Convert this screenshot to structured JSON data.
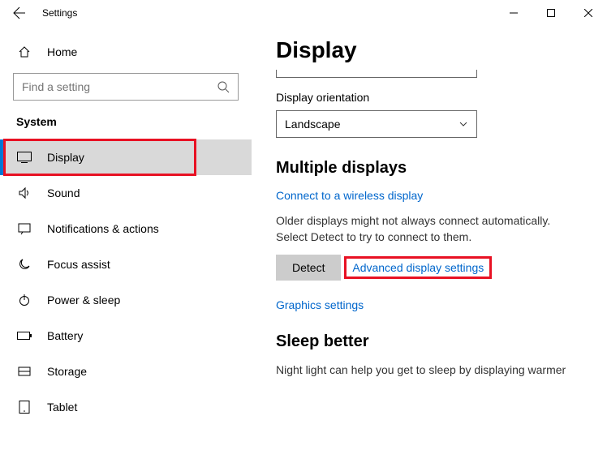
{
  "titlebar": {
    "title": "Settings"
  },
  "sidebar": {
    "home": "Home",
    "search_placeholder": "Find a setting",
    "section": "System",
    "items": [
      {
        "label": "Display"
      },
      {
        "label": "Sound"
      },
      {
        "label": "Notifications & actions"
      },
      {
        "label": "Focus assist"
      },
      {
        "label": "Power & sleep"
      },
      {
        "label": "Battery"
      },
      {
        "label": "Storage"
      },
      {
        "label": "Tablet"
      }
    ]
  },
  "main": {
    "heading": "Display",
    "orientation_label": "Display orientation",
    "orientation_value": "Landscape",
    "multiple_heading": "Multiple displays",
    "wireless_link": "Connect to a wireless display",
    "detect_text": "Older displays might not always connect automatically. Select Detect to try to connect to them.",
    "detect_button": "Detect",
    "advanced_link": "Advanced display settings",
    "graphics_link": "Graphics settings",
    "sleep_heading": "Sleep better",
    "sleep_text": "Night light can help you get to sleep by displaying warmer"
  }
}
